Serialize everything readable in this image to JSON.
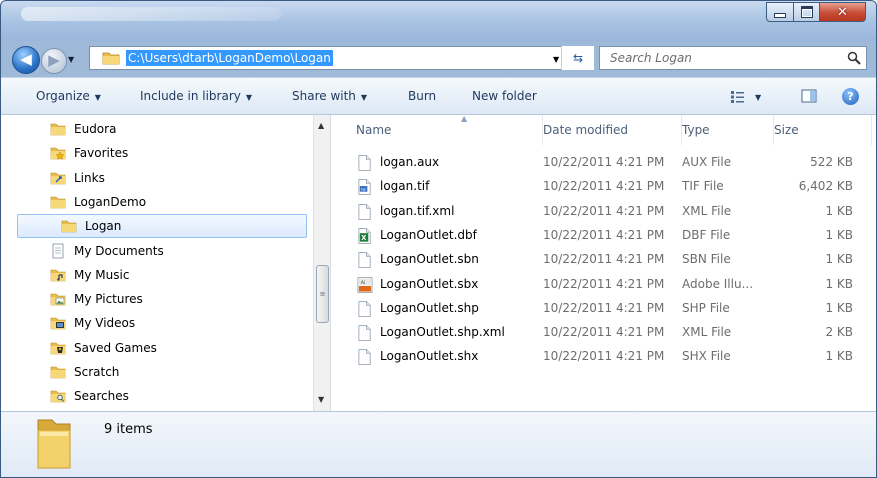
{
  "address": {
    "path": "C:\\Users\\dtarb\\LoganDemo\\Logan"
  },
  "search": {
    "placeholder": "Search Logan"
  },
  "toolbar": {
    "organize": "Organize",
    "include_in_library": "Include in library",
    "share_with": "Share with",
    "burn": "Burn",
    "new_folder": "New folder"
  },
  "nav_items": [
    {
      "label": "Eudora",
      "icon": "folder-icon"
    },
    {
      "label": "Favorites",
      "icon": "favorites-folder-icon"
    },
    {
      "label": "Links",
      "icon": "links-folder-icon"
    },
    {
      "label": "LoganDemo",
      "icon": "folder-icon"
    },
    {
      "label": "Logan",
      "icon": "folder-icon",
      "selected": true
    },
    {
      "label": "My Documents",
      "icon": "documents-icon"
    },
    {
      "label": "My Music",
      "icon": "music-folder-icon"
    },
    {
      "label": "My Pictures",
      "icon": "pictures-folder-icon"
    },
    {
      "label": "My Videos",
      "icon": "videos-folder-icon"
    },
    {
      "label": "Saved Games",
      "icon": "saved-games-icon"
    },
    {
      "label": "Scratch",
      "icon": "folder-icon"
    },
    {
      "label": "Searches",
      "icon": "searches-folder-icon"
    }
  ],
  "columns": {
    "name": "Name",
    "date": "Date modified",
    "type": "Type",
    "size": "Size"
  },
  "files": [
    {
      "name": "logan.aux",
      "date": "10/22/2011 4:21 PM",
      "type": "AUX File",
      "size": "522 KB",
      "icon": "generic-file-icon"
    },
    {
      "name": "logan.tif",
      "date": "10/22/2011 4:21 PM",
      "type": "TIF File",
      "size": "6,402 KB",
      "icon": "tif-image-icon"
    },
    {
      "name": "logan.tif.xml",
      "date": "10/22/2011 4:21 PM",
      "type": "XML File",
      "size": "1 KB",
      "icon": "generic-file-icon"
    },
    {
      "name": "LoganOutlet.dbf",
      "date": "10/22/2011 4:21 PM",
      "type": "DBF File",
      "size": "1 KB",
      "icon": "dbf-excel-icon"
    },
    {
      "name": "LoganOutlet.sbn",
      "date": "10/22/2011 4:21 PM",
      "type": "SBN File",
      "size": "1 KB",
      "icon": "generic-file-icon"
    },
    {
      "name": "LoganOutlet.sbx",
      "date": "10/22/2011 4:21 PM",
      "type": "Adobe Illu...",
      "size": "1 KB",
      "icon": "illustrator-file-icon"
    },
    {
      "name": "LoganOutlet.shp",
      "date": "10/22/2011 4:21 PM",
      "type": "SHP File",
      "size": "1 KB",
      "icon": "generic-file-icon"
    },
    {
      "name": "LoganOutlet.shp.xml",
      "date": "10/22/2011 4:21 PM",
      "type": "XML File",
      "size": "2 KB",
      "icon": "generic-file-icon"
    },
    {
      "name": "LoganOutlet.shx",
      "date": "10/22/2011 4:21 PM",
      "type": "SHX File",
      "size": "1 KB",
      "icon": "generic-file-icon"
    }
  ],
  "details": {
    "item_count": "9 items"
  },
  "colors": {
    "selection_blue": "#3399ff",
    "link_text": "#1e395b",
    "folder_yellow": "#f4d26b"
  }
}
